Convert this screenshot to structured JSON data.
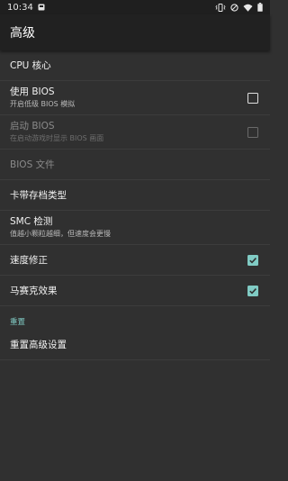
{
  "status_bar": {
    "time": "10:34"
  },
  "app_bar": {
    "title": "高级"
  },
  "settings": {
    "cpu_core": {
      "title": "CPU 核心"
    },
    "use_bios": {
      "title": "使用 BIOS",
      "summary": "开启低级 BIOS 模拟",
      "checked": false
    },
    "boot_bios": {
      "title": "启动 BIOS",
      "summary": "在启动游戏时显示 BIOS 画面",
      "checked": false,
      "enabled": false
    },
    "bios_file": {
      "title": "BIOS 文件",
      "enabled": false
    },
    "save_type": {
      "title": "卡带存档类型"
    },
    "smc_check": {
      "title": "SMC 检测",
      "summary": "值越小颗粒越细，但速度会更慢"
    },
    "speed_fix": {
      "title": "速度修正",
      "checked": true
    },
    "mosaic": {
      "title": "马赛克效果",
      "checked": true
    }
  },
  "reset_section": {
    "header": "重置",
    "reset_advanced": {
      "title": "重置高级设置"
    }
  },
  "colors": {
    "accent": "#80cbc4",
    "background": "#303030",
    "toolbar": "#212121"
  }
}
